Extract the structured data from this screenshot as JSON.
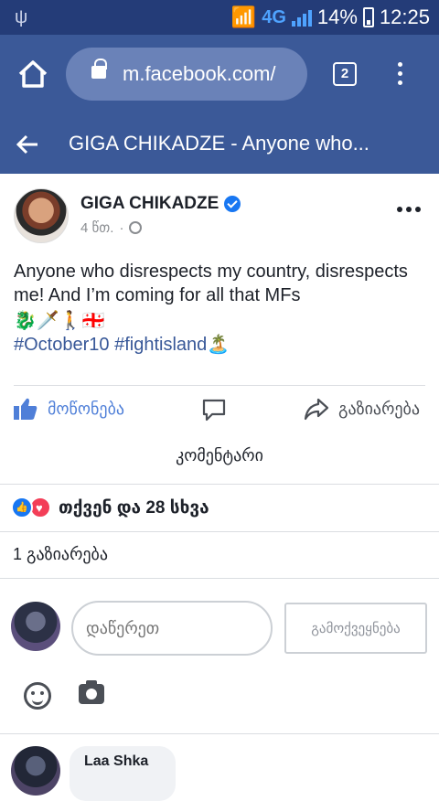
{
  "status_bar": {
    "network": "4G",
    "battery": "14%",
    "time": "12:25"
  },
  "browser": {
    "url": "m.facebook.com/",
    "tab_count": "2"
  },
  "title_bar": {
    "title": "GIGA CHIKADZE - Anyone who..."
  },
  "post": {
    "author": "GIGA CHIKADZE",
    "time": "4 წთ.",
    "text": "Anyone who disrespects my country, disrespects me! And I’m coming for all that MFs",
    "emojis": "🐉🗡️🚶🇬🇪",
    "hashtags": "#October10 #fightisland🏝️"
  },
  "actions": {
    "like": "მოწონება",
    "share": "გაზიარება",
    "comment": "კომენტარი"
  },
  "stats": {
    "reactions": "თქვენ და 28 სხვა",
    "shares": "1 გაზიარება"
  },
  "composer": {
    "placeholder": "დაწერეთ",
    "post_button": "გამოქვეყნება"
  },
  "comments": [
    {
      "author": "Laa Shka"
    }
  ]
}
